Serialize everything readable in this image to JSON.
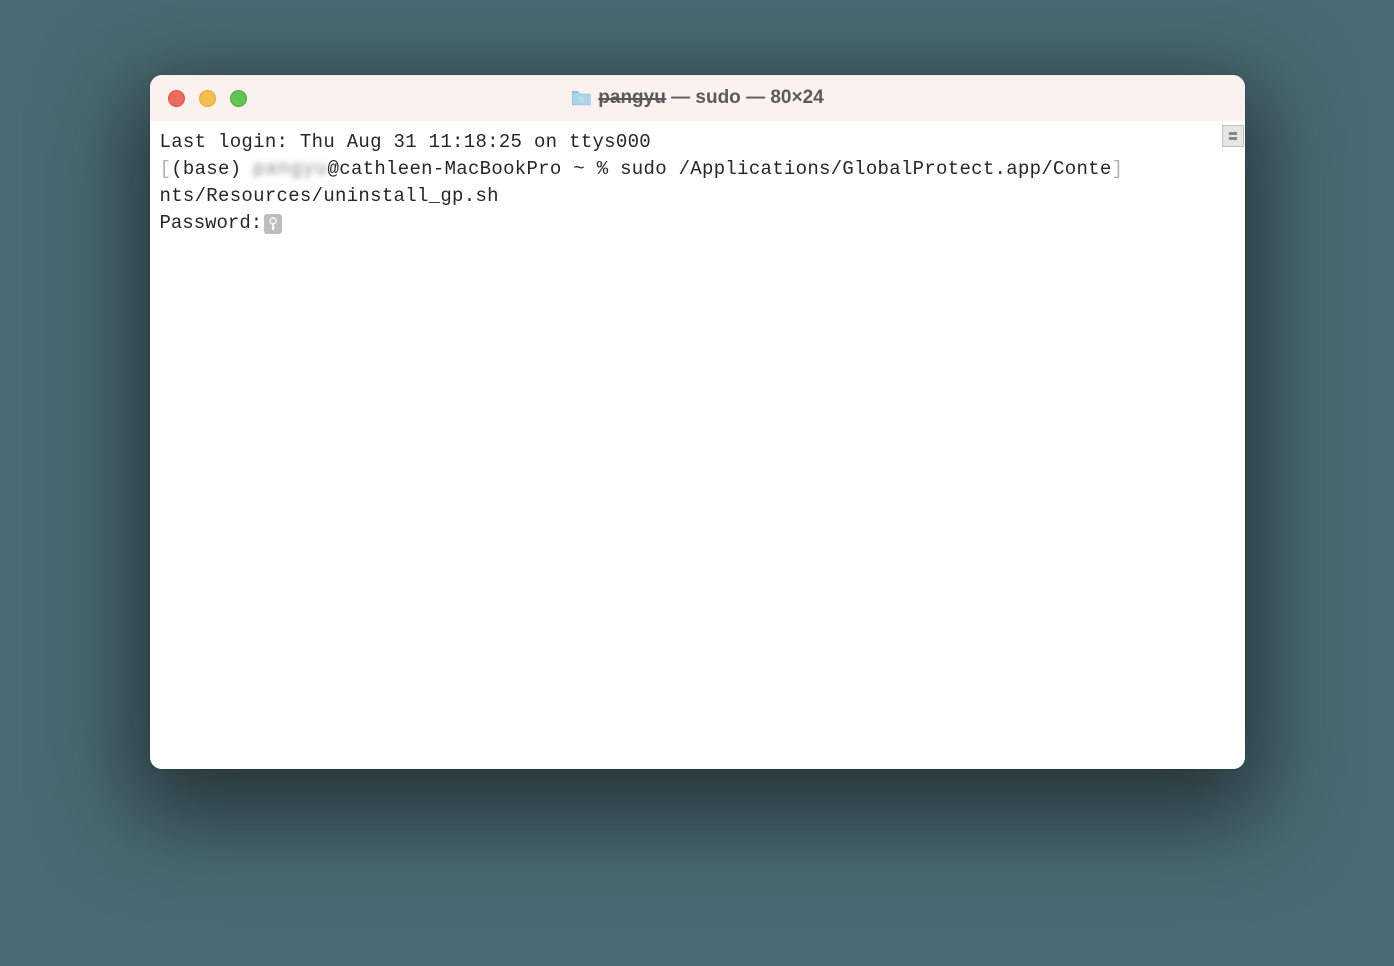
{
  "window": {
    "title_user": "pangyu",
    "title_separator_1": " — ",
    "title_process": "sudo",
    "title_separator_2": " — ",
    "title_dimensions": "80×24"
  },
  "terminal": {
    "last_login": "Last login: Thu Aug 31 11:18:25 on ttys000",
    "prompt_env": "(base) ",
    "prompt_user_blurred": "pangyu",
    "prompt_host": "@cathleen-MacBookPro ~ % ",
    "command": "sudo /Applications/GlobalProtect.app/Conte",
    "command_wrap": "nts/Resources/uninstall_gp.sh",
    "password_label": "Password:"
  }
}
